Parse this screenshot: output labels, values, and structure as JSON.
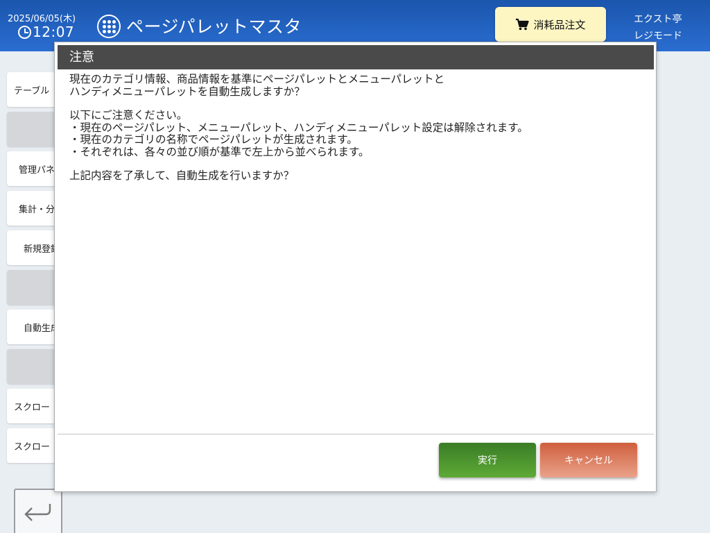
{
  "header": {
    "date": "2025/06/05(木)",
    "time": "12:07",
    "title": "ページパレットマスタ",
    "order_button": "消耗品注文",
    "store": "エクスト亭",
    "mode": "レジモード"
  },
  "sidebar": {
    "items": [
      {
        "label": "テーブル"
      },
      {
        "label": ""
      },
      {
        "label": "管理パネ"
      },
      {
        "label": "集計・分"
      },
      {
        "label": "新規登録"
      },
      {
        "label": ""
      },
      {
        "label": "自動生成"
      },
      {
        "label": ""
      },
      {
        "label": "スクロー"
      },
      {
        "label": "スクロー"
      }
    ]
  },
  "dialog": {
    "title": "注意",
    "paragraph1": [
      "現在のカテゴリ情報、商品情報を基準にページパレットとメニューパレットと",
      "ハンディメニューパレットを自動生成しますか？"
    ],
    "paragraph2": [
      "以下にご注意ください。",
      "・現在のページパレット、メニューパレット、ハンディメニューパレット設定は解除されます。",
      "・現在のカテゴリの名称でページパレットが生成されます。",
      "・それぞれは、各々の並び順が基準で左上から並べられます。"
    ],
    "question": "上記内容を了承して、自動生成を行いますか？",
    "ok_button": "実行",
    "cancel_button": "キャンセル"
  },
  "icons": {
    "clock": "clock-icon",
    "menu": "grid-menu-icon",
    "cart": "cart-icon",
    "back": "back-arrow-icon"
  },
  "colors": {
    "header": "#1b56ad",
    "dialog_title_bg": "#4a4a4a",
    "ok_button": "#4a8f2e",
    "cancel_button": "#dc7a5c",
    "order_button": "#fdf6c3"
  }
}
